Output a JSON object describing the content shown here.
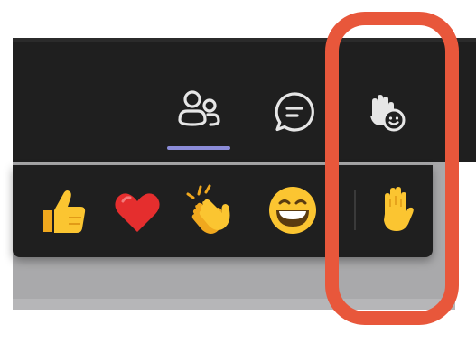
{
  "toolbar": {
    "buttons": [
      {
        "name": "people",
        "icon": "people-icon",
        "active": true
      },
      {
        "name": "chat",
        "icon": "chat-icon",
        "active": false
      },
      {
        "name": "react",
        "icon": "raise-hand-react-icon",
        "active": false
      }
    ]
  },
  "reactions": {
    "items": [
      {
        "name": "like",
        "icon": "thumbs-up-icon"
      },
      {
        "name": "love",
        "icon": "heart-icon"
      },
      {
        "name": "applause",
        "icon": "clapping-hands-icon"
      },
      {
        "name": "laugh",
        "icon": "grinning-face-icon"
      },
      {
        "name": "raise-hand",
        "icon": "raised-hand-icon"
      }
    ]
  },
  "colors": {
    "toolbar_bg": "#1f1f1f",
    "accent_underline": "#8b8cd8",
    "highlight": "#e8573b",
    "icon_stroke": "#e6e6e6"
  }
}
